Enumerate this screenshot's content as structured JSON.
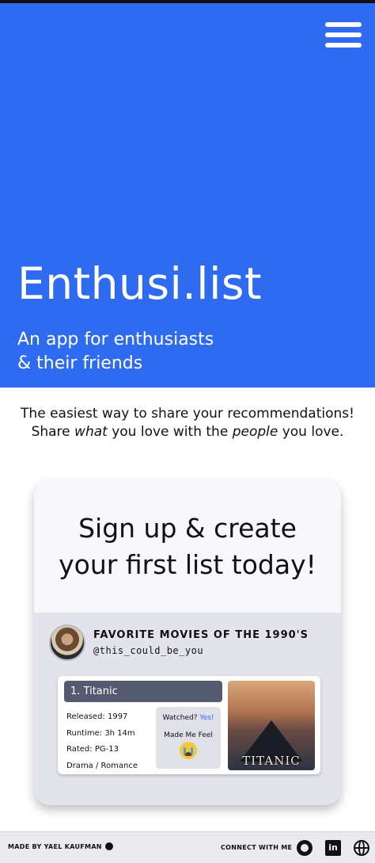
{
  "hero": {
    "title": "Enthusi.list",
    "tagline_line1": "An app for enthusiasts",
    "tagline_line2": "& their friends",
    "bg_color": "#2f6bf0"
  },
  "intro": {
    "line1": "The easiest way to share your recommendations!",
    "line2_part1": "Share ",
    "line2_em1": "what",
    "line2_part2": " you love with the ",
    "line2_em2": "people",
    "line2_part3": " you love."
  },
  "card": {
    "signup_line1": "Sign up & create",
    "signup_line2": "your first list today!",
    "list_title": "FAVORITE MOVIES OF THE 1990'S",
    "handle": "@this_could_be_you",
    "entry": {
      "title": "1. Titanic",
      "released": "Released: 1997",
      "runtime": "Runtime: 3h 14m",
      "rated": "Rated: PG-13",
      "genre": "Drama / Romance",
      "watched_label": "Watched?",
      "watched_value": "Yes!",
      "feel_label": "Made Me Feel",
      "feel_icon": "crying-face-icon",
      "poster_text": "TITANIC"
    }
  },
  "footer": {
    "made_by": "MADE BY YAEL KAUFMAN",
    "connect": "CONNECT WITH ME",
    "linkedin_text": "in",
    "icons": [
      "github-icon",
      "linkedin-icon",
      "globe-icon"
    ]
  }
}
